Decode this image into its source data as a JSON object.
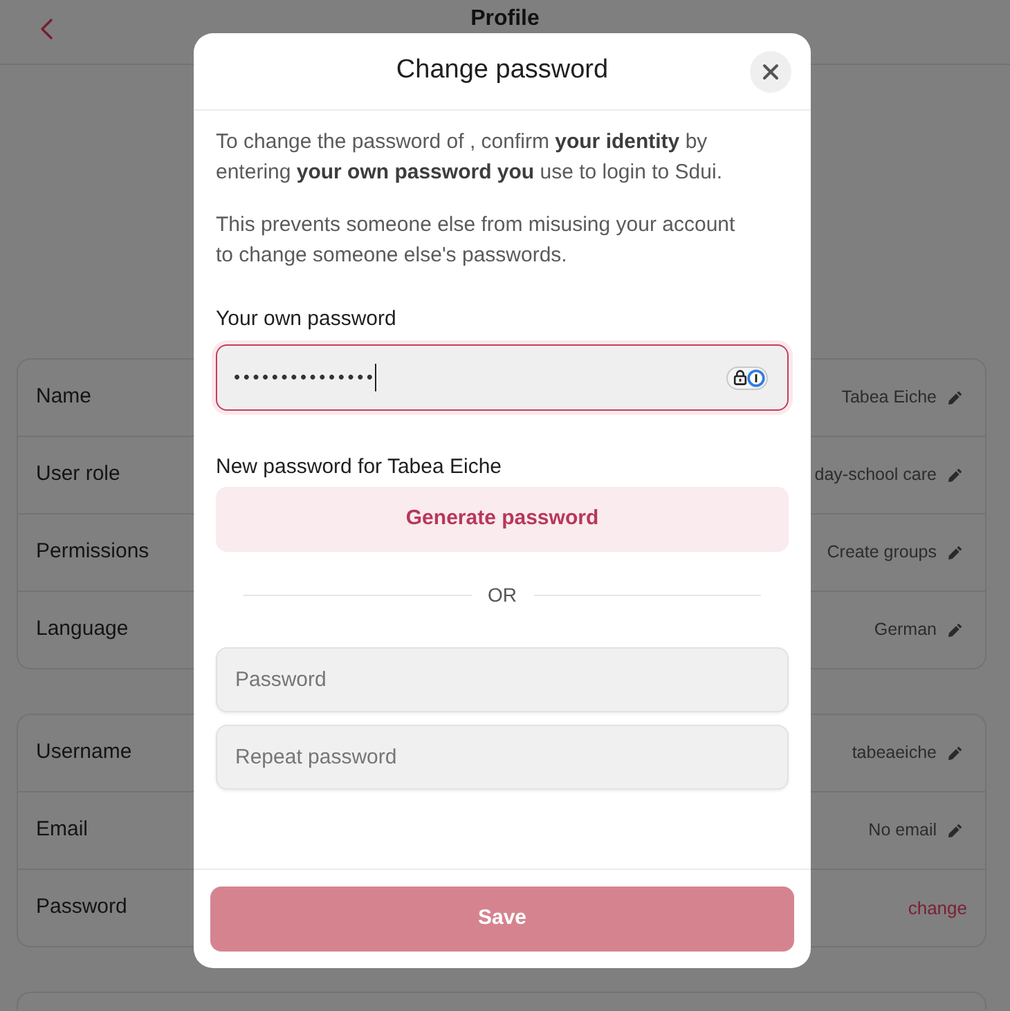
{
  "header": {
    "title": "Profile"
  },
  "profile_sections": [
    {
      "rows": [
        {
          "label": "Name",
          "value": "Tabea Eiche",
          "kind": "editable"
        },
        {
          "label": "User role",
          "value": "day-school care",
          "kind": "editable"
        },
        {
          "label": "Permissions",
          "value": "Create groups",
          "kind": "editable"
        },
        {
          "label": "Language",
          "value": "German",
          "kind": "editable"
        }
      ]
    },
    {
      "rows": [
        {
          "label": "Username",
          "value": "tabeaeiche",
          "kind": "editable"
        },
        {
          "label": "Email",
          "value": "No email",
          "kind": "editable"
        },
        {
          "label": "Password",
          "value": "change",
          "kind": "link"
        }
      ]
    }
  ],
  "dialog": {
    "title": "Change password",
    "intro": "To change the password of , confirm **your identity** by entering **your own password you** use to login to Sdui.",
    "note": "This prevents someone else from misusing your account to change someone else's passwords.",
    "own_password": {
      "label": "Your own password",
      "value": "•••••••••••••••",
      "focused": true
    },
    "new_password": {
      "label": "New password for Tabea Eiche",
      "generate_button": "Generate password",
      "separator": "OR",
      "fields": [
        {
          "placeholder": "Password"
        },
        {
          "placeholder": "Repeat password"
        }
      ]
    },
    "save_button": {
      "label": "Save",
      "disabled": true
    }
  }
}
